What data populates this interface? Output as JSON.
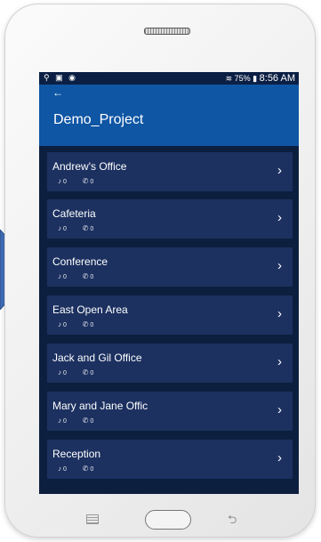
{
  "status_bar": {
    "left_icons": "⚲ ▣ ◉",
    "right_icons": "≋ 75% ▮",
    "time": "8:56 AM"
  },
  "app_bar": {
    "back_icon": "←",
    "title": "Demo_Project"
  },
  "meta_icons": {
    "sound": "♪",
    "call": "✆"
  },
  "rooms": [
    {
      "name": "Andrew's Office",
      "sound_value": "0",
      "call_value": "0"
    },
    {
      "name": "Cafeteria",
      "sound_value": "0",
      "call_value": "0"
    },
    {
      "name": "Conference",
      "sound_value": "0",
      "call_value": "0"
    },
    {
      "name": "East Open Area",
      "sound_value": "0",
      "call_value": "0"
    },
    {
      "name": "Jack and Gil Office",
      "sound_value": "0",
      "call_value": "0"
    },
    {
      "name": "Mary and Jane Offic",
      "sound_value": "0",
      "call_value": "0"
    },
    {
      "name": "Reception",
      "sound_value": "0",
      "call_value": "0"
    }
  ],
  "chevron": "›",
  "nav": {
    "back_glyph": "⮌"
  },
  "colors": {
    "app_bar": "#0f56a4",
    "card": "#1c3160",
    "list_bg": "#0d1f3f",
    "side_arrow": "#3f6fb8"
  }
}
